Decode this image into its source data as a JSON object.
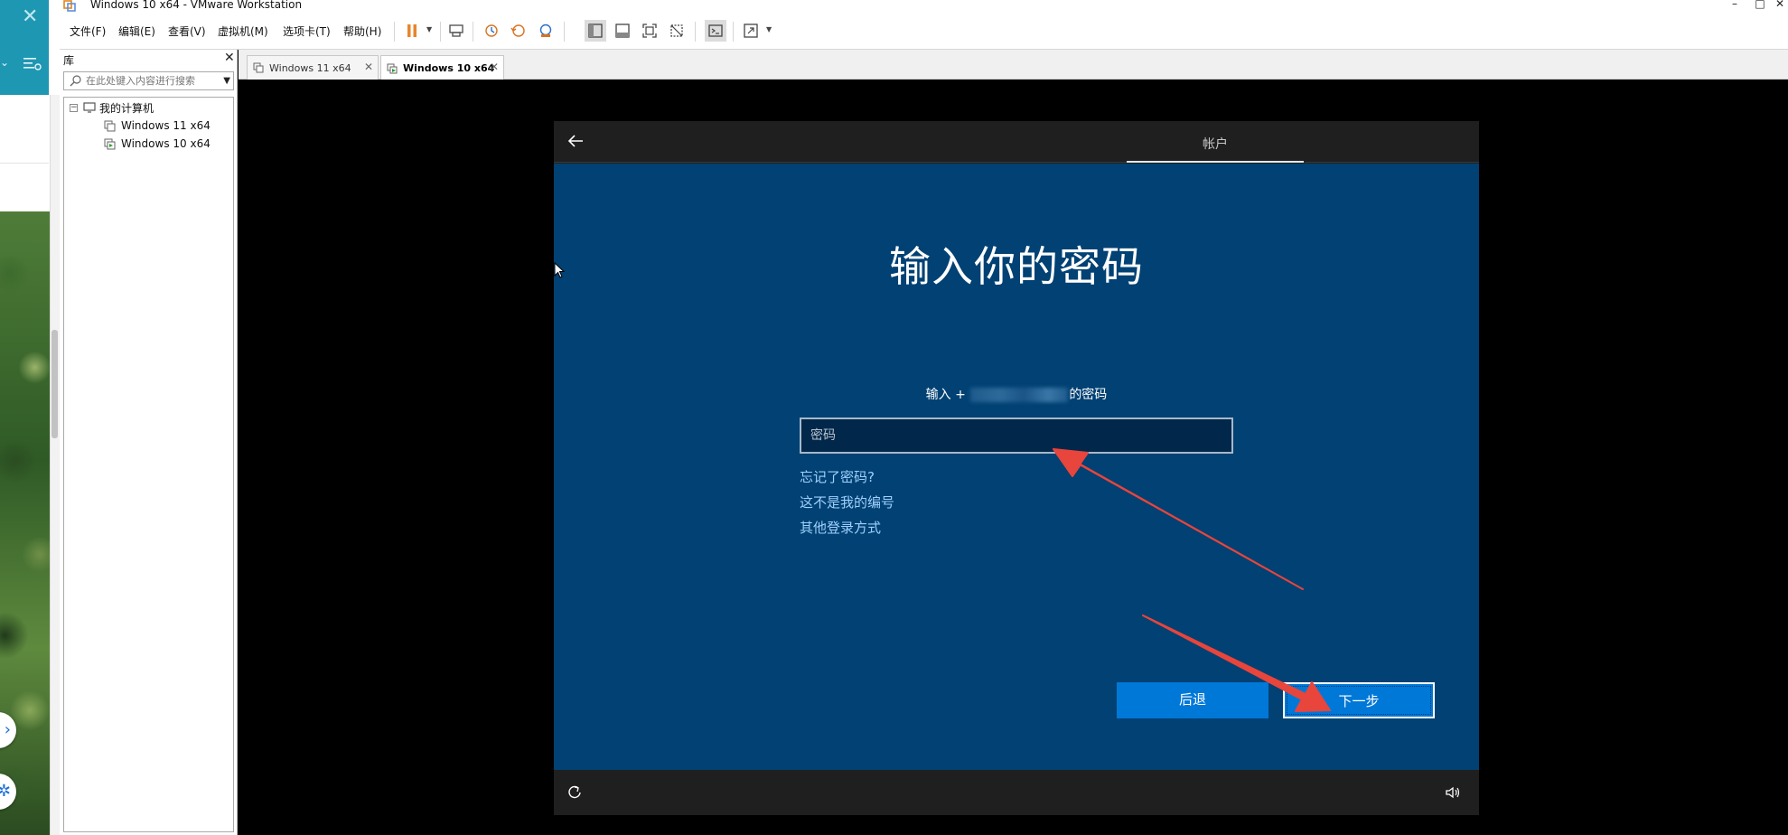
{
  "window": {
    "title": "Windows 10 x64 - VMware Workstation",
    "minimize": "–",
    "maximize": "□",
    "close": "✕"
  },
  "menubar": {
    "items": [
      "文件(F)",
      "编辑(E)",
      "查看(V)",
      "虚拟机(M)",
      "选项卡(T)",
      "帮助(H)"
    ]
  },
  "library": {
    "header": "库",
    "close": "✕",
    "search_placeholder": "在此处键入内容进行搜索",
    "tree": {
      "root": "我的计算机",
      "expander": "−",
      "vms": [
        "Windows 11 x64",
        "Windows 10 x64"
      ]
    }
  },
  "tabs": [
    {
      "label": "Windows 11 x64",
      "active": false
    },
    {
      "label": "Windows 10 x64",
      "active": true
    }
  ],
  "tab_close": "✕",
  "oobe": {
    "section_tab": "帐户",
    "heading": "输入你的密码",
    "prompt_prefix": "输入 +",
    "prompt_suffix": "的密码",
    "password_placeholder": "密码",
    "links": [
      "忘记了密码?",
      "这不是我的编号",
      "其他登录方式"
    ],
    "back_button": "后退",
    "next_button": "下一步"
  },
  "colors": {
    "oobe_background": "#014173",
    "button_blue": "#0078d7",
    "link_color": "#9fd0ff",
    "annotation_arrow": "#e8453c"
  }
}
